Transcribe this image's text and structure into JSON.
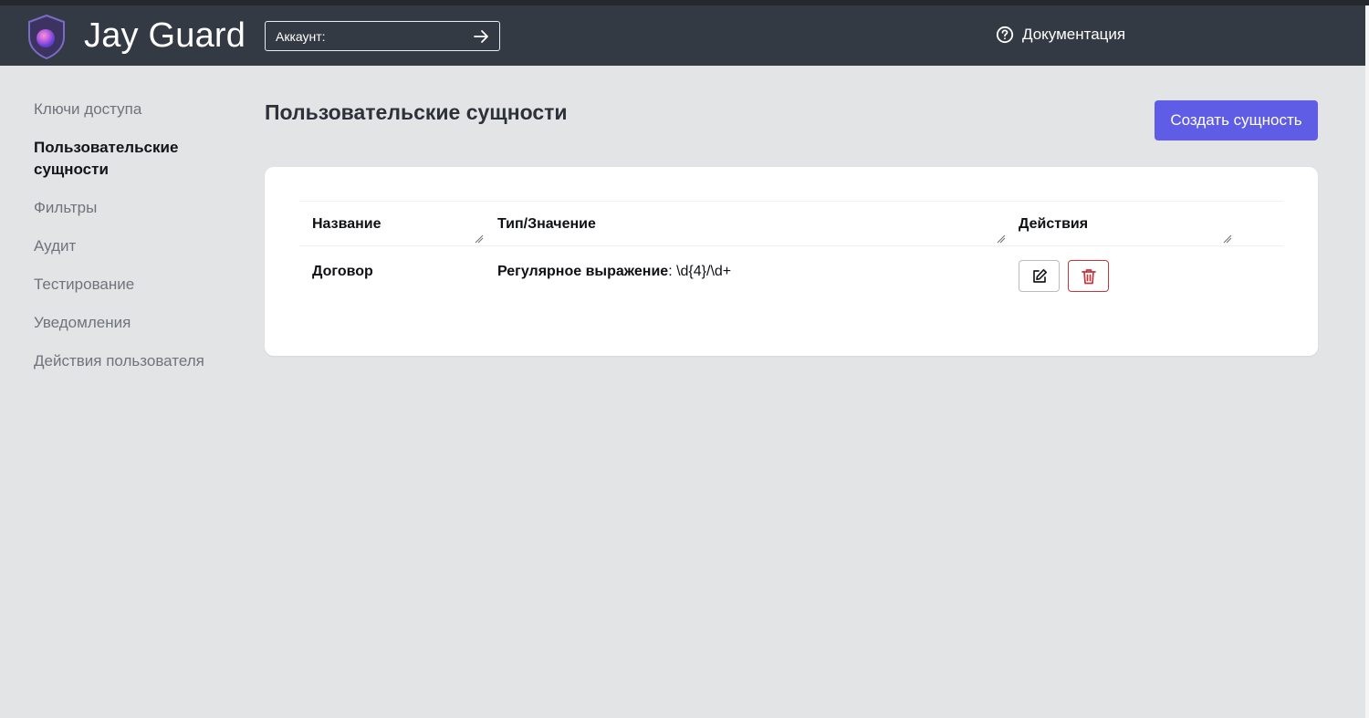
{
  "header": {
    "brand": "Jay Guard",
    "account_label": "Аккаунт:",
    "docs_label": "Документация"
  },
  "sidebar": {
    "items": [
      {
        "label": "Ключи доступа",
        "active": false
      },
      {
        "label": "Пользовательские сущности",
        "active": true
      },
      {
        "label": "Фильтры",
        "active": false
      },
      {
        "label": "Аудит",
        "active": false
      },
      {
        "label": "Тестирование",
        "active": false
      },
      {
        "label": "Уведомления",
        "active": false
      },
      {
        "label": "Действия пользователя",
        "active": false
      }
    ]
  },
  "main": {
    "title": "Пользовательские сущности",
    "create_button": "Создать сущность",
    "table": {
      "columns": [
        "Название",
        "Тип/Значение",
        "Действия"
      ],
      "rows": [
        {
          "name": "Договор",
          "type": "Регулярное выражение",
          "value": ": \\d{4}/\\d+"
        }
      ]
    }
  },
  "colors": {
    "header_bg": "#343a44",
    "page_bg": "#e3e4e6",
    "accent": "#5f5ce6",
    "danger": "#c3363c"
  },
  "icons": [
    "shield-logo-icon",
    "arrow-right-icon",
    "help-circle-icon",
    "edit-icon",
    "trash-icon"
  ]
}
